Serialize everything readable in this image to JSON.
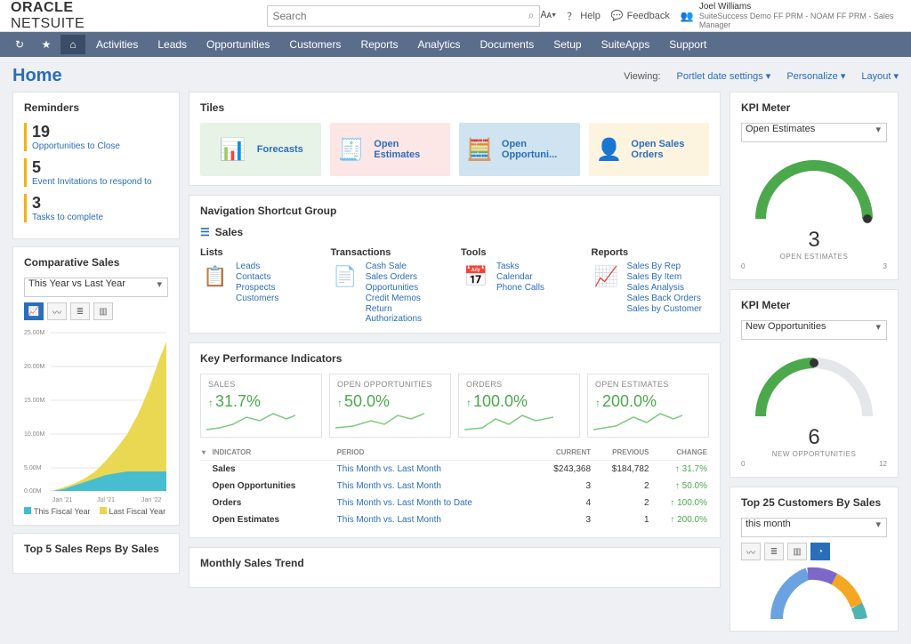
{
  "brand": {
    "word1": "ORACLE",
    "word2": "NETSUITE"
  },
  "search": {
    "placeholder": "Search"
  },
  "top_right": {
    "help": "Help",
    "feedback": "Feedback",
    "user_name": "Joel Williams",
    "user_sub": "SuiteSuccess Demo FF PRM - NOAM FF PRM - Sales Manager"
  },
  "nav": [
    "Activities",
    "Leads",
    "Opportunities",
    "Customers",
    "Reports",
    "Analytics",
    "Documents",
    "Setup",
    "SuiteApps",
    "Support"
  ],
  "page": {
    "title": "Home",
    "viewing_lbl": "Viewing:",
    "viewing_val": "Portlet date settings",
    "personalize": "Personalize",
    "layout": "Layout"
  },
  "reminders": {
    "title": "Reminders",
    "items": [
      {
        "count": "19",
        "label": "Opportunities to Close"
      },
      {
        "count": "5",
        "label": "Event Invitations to respond to"
      },
      {
        "count": "3",
        "label": "Tasks to complete"
      }
    ]
  },
  "comparative": {
    "title": "Comparative Sales",
    "select": "This Year vs Last Year",
    "legend1": "This Fiscal Year",
    "legend2": "Last Fiscal Year"
  },
  "top5": {
    "title": "Top 5 Sales Reps By Sales"
  },
  "tiles": {
    "title": "Tiles",
    "items": [
      "Forecasts",
      "Open Estimates",
      "Open Opportuni...",
      "Open Sales Orders"
    ]
  },
  "shortcut": {
    "title": "Navigation Shortcut Group",
    "sub": "Sales",
    "lists": {
      "title": "Lists",
      "links": [
        "Leads",
        "Contacts",
        "Prospects",
        "Customers"
      ]
    },
    "transactions": {
      "title": "Transactions",
      "links": [
        "Cash Sale",
        "Sales Orders",
        "Opportunities",
        "Credit Memos",
        "Return Authorizations"
      ]
    },
    "tools": {
      "title": "Tools",
      "links": [
        "Tasks",
        "Calendar",
        "Phone Calls"
      ]
    },
    "reports": {
      "title": "Reports",
      "links": [
        "Sales By Rep",
        "Sales By Item",
        "Sales Analysis",
        "Sales Back Orders",
        "Sales by Customer"
      ]
    }
  },
  "kpi": {
    "title": "Key Performance Indicators",
    "boxes": [
      {
        "head": "SALES",
        "val": "31.7%"
      },
      {
        "head": "OPEN OPPORTUNITIES",
        "val": "50.0%"
      },
      {
        "head": "ORDERS",
        "val": "100.0%"
      },
      {
        "head": "OPEN ESTIMATES",
        "val": "200.0%"
      }
    ],
    "table_head": [
      "",
      "INDICATOR",
      "PERIOD",
      "CURRENT",
      "PREVIOUS",
      "CHANGE"
    ],
    "rows": [
      {
        "ind": "Sales",
        "period": "This Month vs. Last Month",
        "curr": "$243,368",
        "prev": "$184,782",
        "chg": "31.7%"
      },
      {
        "ind": "Open Opportunities",
        "period": "This Month vs. Last Month",
        "curr": "3",
        "prev": "2",
        "chg": "50.0%"
      },
      {
        "ind": "Orders",
        "period": "This Month vs. Last Month to Date",
        "curr": "4",
        "prev": "2",
        "chg": "100.0%"
      },
      {
        "ind": "Open Estimates",
        "period": "This Month vs. Last Month",
        "curr": "3",
        "prev": "1",
        "chg": "200.0%"
      }
    ]
  },
  "monthly": {
    "title": "Monthly Sales Trend"
  },
  "meter1": {
    "title": "KPI Meter",
    "select": "Open Estimates",
    "val": "3",
    "lbl": "OPEN ESTIMATES",
    "lo": "0",
    "hi": "3"
  },
  "meter2": {
    "title": "KPI Meter",
    "select": "New Opportunities",
    "val": "6",
    "lbl": "NEW OPPORTUNITIES",
    "lo": "0",
    "hi": "12"
  },
  "top25": {
    "title": "Top 25 Customers By Sales",
    "select": "this month"
  },
  "chart_data": {
    "comparative_sales": {
      "type": "area",
      "xlabel": "",
      "ylabel": "",
      "x": [
        "Jan '21",
        "Jul '21",
        "Jan '22"
      ],
      "ylim": [
        0,
        25
      ],
      "yunit": "M",
      "yticks": [
        "25.00M",
        "20.00M",
        "15.00M",
        "10.00M",
        "5.00M",
        "0.00M"
      ],
      "series": [
        {
          "name": "Last Fiscal Year",
          "color": "#e9d64a",
          "values": [
            0,
            0.5,
            1,
            2,
            3,
            4,
            6,
            8,
            10,
            13,
            17,
            21.5
          ]
        },
        {
          "name": "This Fiscal Year",
          "color": "#3dbdd6",
          "values": [
            0,
            0.3,
            0.8,
            1.4,
            2,
            2.5,
            2.8,
            3,
            3,
            3,
            3,
            3
          ]
        }
      ]
    },
    "kpi_meters": [
      {
        "label": "Open Estimates",
        "value": 3,
        "min": 0,
        "max": 3
      },
      {
        "label": "New Opportunities",
        "value": 6,
        "min": 0,
        "max": 12
      }
    ]
  }
}
